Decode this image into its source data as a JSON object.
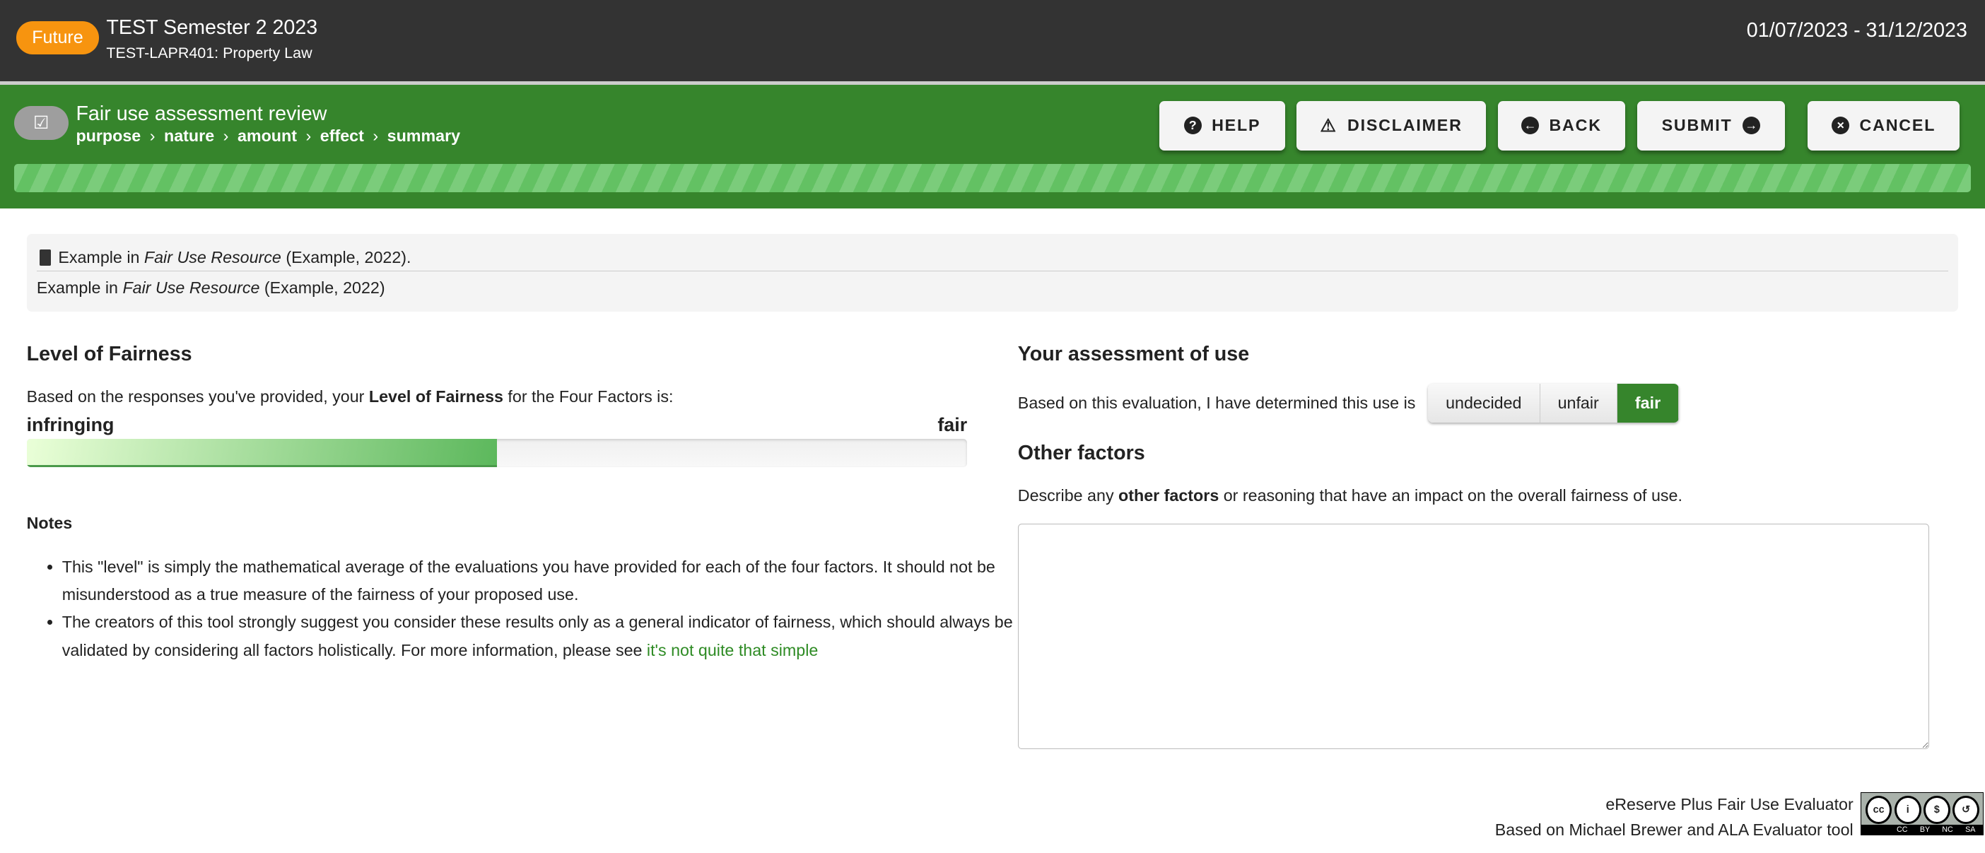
{
  "header": {
    "badge": "Future",
    "term": "TEST Semester 2 2023",
    "course": "TEST-LAPR401: Property Law",
    "dates": "01/07/2023 - 31/12/2023"
  },
  "wizard": {
    "title": "Fair use assessment review",
    "steps": [
      "purpose",
      "nature",
      "amount",
      "effect",
      "summary"
    ],
    "separator": "›",
    "buttons": {
      "help": "HELP",
      "disclaimer": "DISCLAIMER",
      "back": "BACK",
      "submit": "SUBMIT",
      "cancel": "CANCEL"
    }
  },
  "citation": {
    "line1_pre": "Example in ",
    "line1_title": "Fair Use Resource",
    "line1_post": " (Example, 2022).",
    "line2_pre": "Example in ",
    "line2_title": "Fair Use Resource",
    "line2_post": " (Example, 2022)"
  },
  "fairness": {
    "heading": "Level of Fairness",
    "intro_pre": "Based on the responses you've provided, your ",
    "intro_bold": "Level of Fairness",
    "intro_post": " for the Four Factors is:",
    "left_label": "infringing",
    "right_label": "fair",
    "level_percent": 50,
    "notes_heading": "Notes",
    "notes": [
      "This \"level\" is simply the mathematical average of the evaluations you have provided for each of the four factors. It should not be misunderstood as a true measure of the fairness of your proposed use.",
      "The creators of this tool strongly suggest you consider these results only as a general indicator of fairness, which should always be validated by considering all factors holistically. For more information, please see "
    ],
    "notes_link": "it's not quite that simple"
  },
  "assessment": {
    "heading": "Your assessment of use",
    "prompt": "Based on this evaluation, I have determined this use is",
    "options": [
      "undecided",
      "unfair",
      "fair"
    ],
    "selected": "fair"
  },
  "other": {
    "heading": "Other factors",
    "desc_pre": "Describe any ",
    "desc_bold": "other factors",
    "desc_post": " or reasoning that have an impact on the overall fairness of use.",
    "value": ""
  },
  "footer": {
    "line1": "eReserve Plus Fair Use Evaluator",
    "line2": "Based on Michael Brewer and ALA Evaluator tool",
    "license": "CC BY NC SA"
  }
}
